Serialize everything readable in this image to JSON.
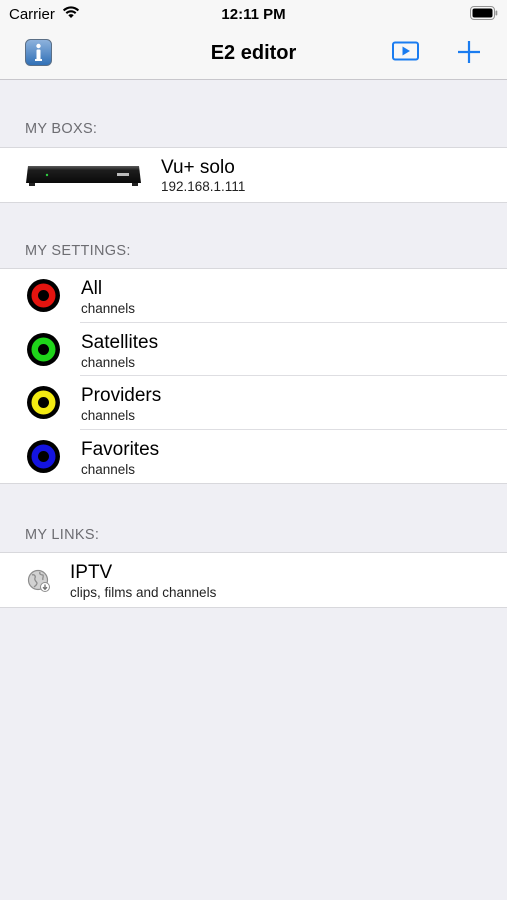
{
  "status_bar": {
    "carrier": "Carrier",
    "time": "12:11 PM"
  },
  "nav": {
    "title": "E2 editor",
    "info_icon": "info-icon",
    "play_icon": "play-icon",
    "add_icon": "plus-icon",
    "accent": "#1a7cf0"
  },
  "sections": {
    "boxes": {
      "header": "MY BOXS:",
      "items": [
        {
          "title": "Vu+ solo",
          "subtitle": "192.168.1.111",
          "icon": "receiver-box-image"
        }
      ]
    },
    "settings": {
      "header": "MY SETTINGS:",
      "items": [
        {
          "title": "All",
          "subtitle": "channels",
          "color": "#e4140f"
        },
        {
          "title": "Satellites",
          "subtitle": "channels",
          "color": "#1fd51a"
        },
        {
          "title": "Providers",
          "subtitle": "channels",
          "color": "#f2ea12"
        },
        {
          "title": "Favorites",
          "subtitle": "channels",
          "color": "#1414e0"
        }
      ]
    },
    "links": {
      "header": "MY LINKS:",
      "items": [
        {
          "title": "IPTV",
          "subtitle": "clips, films and channels",
          "icon": "globe-icon"
        }
      ]
    }
  }
}
